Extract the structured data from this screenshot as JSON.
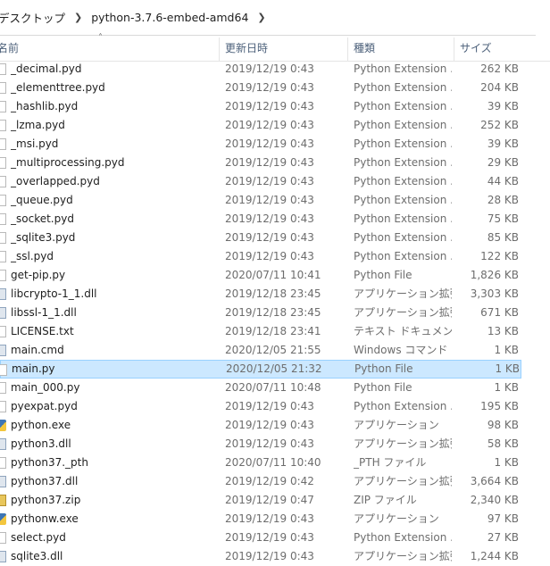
{
  "breadcrumb": {
    "items": [
      "デスクトップ",
      "python-3.7.6-embed-amd64"
    ]
  },
  "columns": {
    "name": "名前",
    "date": "更新日時",
    "type": "種類",
    "size": "サイズ"
  },
  "files": [
    {
      "name": "_decimal.pyd",
      "date": "2019/12/19 0:43",
      "type": "Python Extension ...",
      "size": "262 KB",
      "icon": "file-icon"
    },
    {
      "name": "_elementtree.pyd",
      "date": "2019/12/19 0:43",
      "type": "Python Extension ...",
      "size": "204 KB",
      "icon": "file-icon"
    },
    {
      "name": "_hashlib.pyd",
      "date": "2019/12/19 0:43",
      "type": "Python Extension ...",
      "size": "39 KB",
      "icon": "file-icon"
    },
    {
      "name": "_lzma.pyd",
      "date": "2019/12/19 0:43",
      "type": "Python Extension ...",
      "size": "252 KB",
      "icon": "file-icon"
    },
    {
      "name": "_msi.pyd",
      "date": "2019/12/19 0:43",
      "type": "Python Extension ...",
      "size": "39 KB",
      "icon": "file-icon"
    },
    {
      "name": "_multiprocessing.pyd",
      "date": "2019/12/19 0:43",
      "type": "Python Extension ...",
      "size": "29 KB",
      "icon": "file-icon"
    },
    {
      "name": "_overlapped.pyd",
      "date": "2019/12/19 0:43",
      "type": "Python Extension ...",
      "size": "44 KB",
      "icon": "file-icon"
    },
    {
      "name": "_queue.pyd",
      "date": "2019/12/19 0:43",
      "type": "Python Extension ...",
      "size": "28 KB",
      "icon": "file-icon"
    },
    {
      "name": "_socket.pyd",
      "date": "2019/12/19 0:43",
      "type": "Python Extension ...",
      "size": "75 KB",
      "icon": "file-icon"
    },
    {
      "name": "_sqlite3.pyd",
      "date": "2019/12/19 0:43",
      "type": "Python Extension ...",
      "size": "85 KB",
      "icon": "file-icon"
    },
    {
      "name": "_ssl.pyd",
      "date": "2019/12/19 0:43",
      "type": "Python Extension ...",
      "size": "122 KB",
      "icon": "file-icon"
    },
    {
      "name": "get-pip.py",
      "date": "2020/07/11 10:41",
      "type": "Python File",
      "size": "1,826 KB",
      "icon": "file-icon"
    },
    {
      "name": "libcrypto-1_1.dll",
      "date": "2019/12/18 23:45",
      "type": "アプリケーション拡張",
      "size": "3,303 KB",
      "icon": "dll-icon"
    },
    {
      "name": "libssl-1_1.dll",
      "date": "2019/12/18 23:45",
      "type": "アプリケーション拡張",
      "size": "671 KB",
      "icon": "dll-icon"
    },
    {
      "name": "LICENSE.txt",
      "date": "2019/12/18 23:41",
      "type": "テキスト ドキュメント",
      "size": "13 KB",
      "icon": "file-icon"
    },
    {
      "name": "main.cmd",
      "date": "2020/12/05 21:55",
      "type": "Windows コマンド ...",
      "size": "1 KB",
      "icon": "gear-icon"
    },
    {
      "name": "main.py",
      "date": "2020/12/05 21:32",
      "type": "Python File",
      "size": "1 KB",
      "icon": "file-icon",
      "selected": true
    },
    {
      "name": "main_000.py",
      "date": "2020/07/11 10:48",
      "type": "Python File",
      "size": "1 KB",
      "icon": "file-icon"
    },
    {
      "name": "pyexpat.pyd",
      "date": "2019/12/19 0:43",
      "type": "Python Extension ...",
      "size": "195 KB",
      "icon": "file-icon"
    },
    {
      "name": "python.exe",
      "date": "2019/12/19 0:43",
      "type": "アプリケーション",
      "size": "98 KB",
      "icon": "python-icon"
    },
    {
      "name": "python3.dll",
      "date": "2019/12/19 0:43",
      "type": "アプリケーション拡張",
      "size": "58 KB",
      "icon": "dll-icon"
    },
    {
      "name": "python37._pth",
      "date": "2020/07/11 10:40",
      "type": "_PTH ファイル",
      "size": "1 KB",
      "icon": "file-icon"
    },
    {
      "name": "python37.dll",
      "date": "2019/12/19 0:42",
      "type": "アプリケーション拡張",
      "size": "3,664 KB",
      "icon": "dll-icon"
    },
    {
      "name": "python37.zip",
      "date": "2019/12/19 0:47",
      "type": "ZIP ファイル",
      "size": "2,340 KB",
      "icon": "zip-icon"
    },
    {
      "name": "pythonw.exe",
      "date": "2019/12/19 0:43",
      "type": "アプリケーション",
      "size": "97 KB",
      "icon": "python-icon"
    },
    {
      "name": "select.pyd",
      "date": "2019/12/19 0:43",
      "type": "Python Extension ...",
      "size": "27 KB",
      "icon": "file-icon"
    },
    {
      "name": "sqlite3.dll",
      "date": "2019/12/19 0:43",
      "type": "アプリケーション拡張",
      "size": "1,244 KB",
      "icon": "dll-icon"
    }
  ],
  "colors": {
    "selected_bg": "#cce8ff",
    "selected_border": "#99d1ff",
    "header_text": "#4c607a"
  }
}
